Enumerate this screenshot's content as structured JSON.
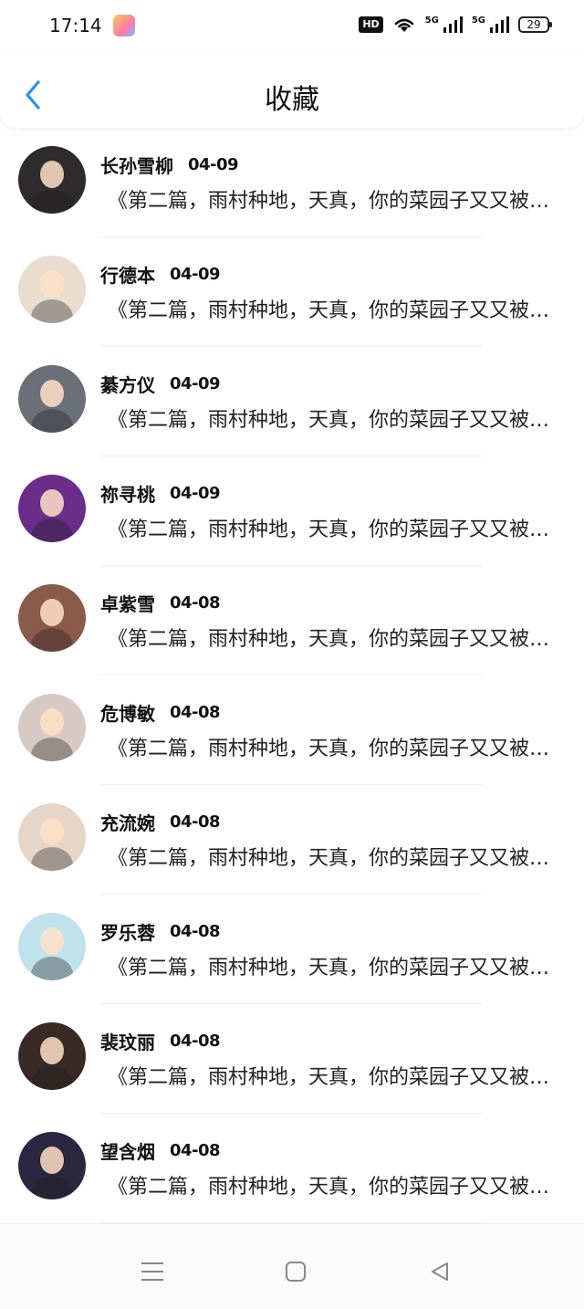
{
  "status_bar": {
    "time": "17:14",
    "hd_label": "HD",
    "signal_1": "5G",
    "signal_2": "5G",
    "battery": "29"
  },
  "header": {
    "title": "收藏"
  },
  "icons": {
    "back": "chevron-left-icon",
    "nav_menu": "menu-icon",
    "nav_home": "home-square-icon",
    "nav_back": "triangle-back-icon"
  },
  "colors": {
    "accent": "#2b8ff0"
  },
  "items": [
    {
      "name": "长孙雪柳",
      "date": "04-09",
      "content": "《第二篇，雨村种地，天真，你的菜园子又又被拱了》",
      "avatar_bg": "#2f2a2c"
    },
    {
      "name": "行德本",
      "date": "04-09",
      "content": "《第二篇，雨村种地，天真，你的菜园子又又被拱了》",
      "avatar_bg": "#e9ddd0"
    },
    {
      "name": "綦方仪",
      "date": "04-09",
      "content": "《第二篇，雨村种地，天真，你的菜园子又又被拱了》",
      "avatar_bg": "#6b6f78"
    },
    {
      "name": "祢寻桃",
      "date": "04-09",
      "content": "《第二篇，雨村种地，天真，你的菜园子又又被拱了》",
      "avatar_bg": "#6a2d8a"
    },
    {
      "name": "卓紫雪",
      "date": "04-08",
      "content": "《第二篇，雨村种地，天真，你的菜园子又又被拱了》",
      "avatar_bg": "#8a5a4a"
    },
    {
      "name": "危博敏",
      "date": "04-08",
      "content": "《第二篇，雨村种地，天真，你的菜园子又又被拱了》",
      "avatar_bg": "#d8c9c4"
    },
    {
      "name": "充流婉",
      "date": "04-08",
      "content": "《第二篇，雨村种地，天真，你的菜园子又又被拱了》",
      "avatar_bg": "#e6d6c8"
    },
    {
      "name": "罗乐蓉",
      "date": "04-08",
      "content": "《第二篇，雨村种地，天真，你的菜园子又又被拱了》",
      "avatar_bg": "#bfe2ec"
    },
    {
      "name": "裴玟丽",
      "date": "04-08",
      "content": "《第二篇，雨村种地，天真，你的菜园子又又被拱了》",
      "avatar_bg": "#3a2a26"
    },
    {
      "name": "望含烟",
      "date": "04-08",
      "content": "《第二篇，雨村种地，天真，你的菜园子又又被拱了》",
      "avatar_bg": "#2c2740"
    }
  ]
}
